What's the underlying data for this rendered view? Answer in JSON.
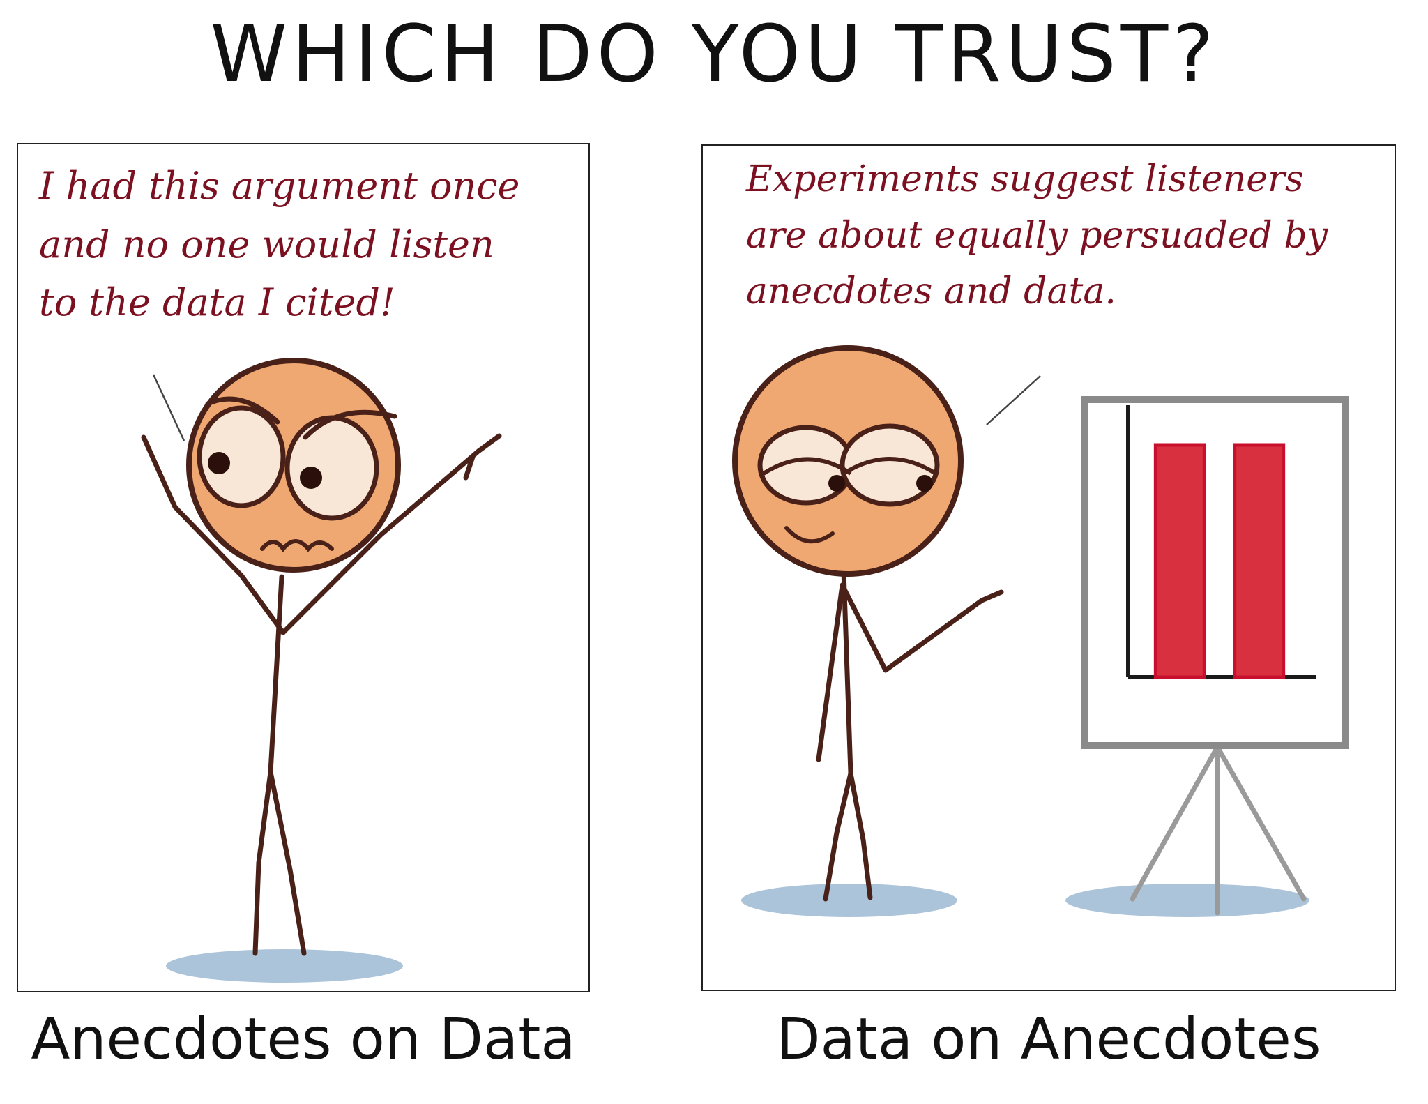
{
  "title": "WHICH DO YOU TRUST?",
  "panels": [
    {
      "speech_lines": [
        "I had this argument once",
        "and no one would listen",
        "to the data I cited!"
      ],
      "caption": "Anecdotes on Data"
    },
    {
      "speech_lines": [
        "Experiments suggest listeners",
        "are about equally persuaded by",
        "anecdotes and data."
      ],
      "caption": "Data on Anecdotes"
    }
  ],
  "colors": {
    "speech_text": "#7b1020",
    "head_fill": "#f0a872",
    "body_stroke": "#4a2118",
    "bar_fill": "#d9303f",
    "ground": "#8fb0cc",
    "easel": "#8a8a8a"
  },
  "chart_data": {
    "type": "bar",
    "categories": [
      "",
      ""
    ],
    "values": [
      0.9,
      0.9
    ],
    "title": "",
    "xlabel": "",
    "ylabel": ""
  }
}
